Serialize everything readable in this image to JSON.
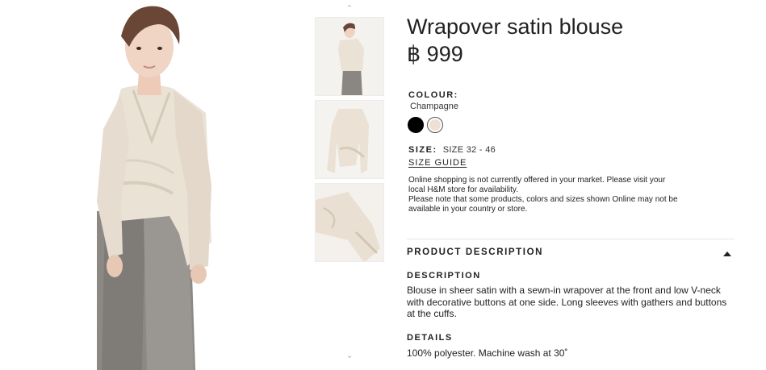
{
  "product": {
    "title": "Wrapover satin blouse",
    "price": "฿ 999"
  },
  "gallery": {
    "main_image": "model-wearing-champagne-wrapover-satin-blouse",
    "thumbnails": [
      "model-front-view",
      "flat-lay-blouse",
      "sleeve-cuff-detail"
    ],
    "up_arrow_icon": "chevron-up-icon",
    "down_arrow_icon": "chevron-down-icon",
    "up_glyph": "⌃",
    "down_glyph": "⌄"
  },
  "colour": {
    "label": "COLOUR:",
    "selected": "Champagne",
    "swatches": [
      {
        "name": "black",
        "hex": "#000000"
      },
      {
        "name": "champagne",
        "hex": "#efe0d5"
      }
    ]
  },
  "size": {
    "label": "SIZE:",
    "value": "SIZE 32 - 46",
    "guide_link": "SIZE GUIDE"
  },
  "notice": {
    "line1": "Online shopping is not currently offered in your market. Please visit your local H&M store for availability.",
    "line2": "Please note that some products, colors and sizes shown Online may not be available in your country or store."
  },
  "product_description": {
    "header": "PRODUCT DESCRIPTION",
    "description_heading": "DESCRIPTION",
    "description_text": "Blouse in sheer satin with a sewn-in wrapover at the front and low V-neck with decorative buttons at one side. Long sleeves with gathers and buttons at the cuffs.",
    "details_heading": "DETAILS",
    "details_text": "100% polyester. Machine wash at 30˚"
  }
}
